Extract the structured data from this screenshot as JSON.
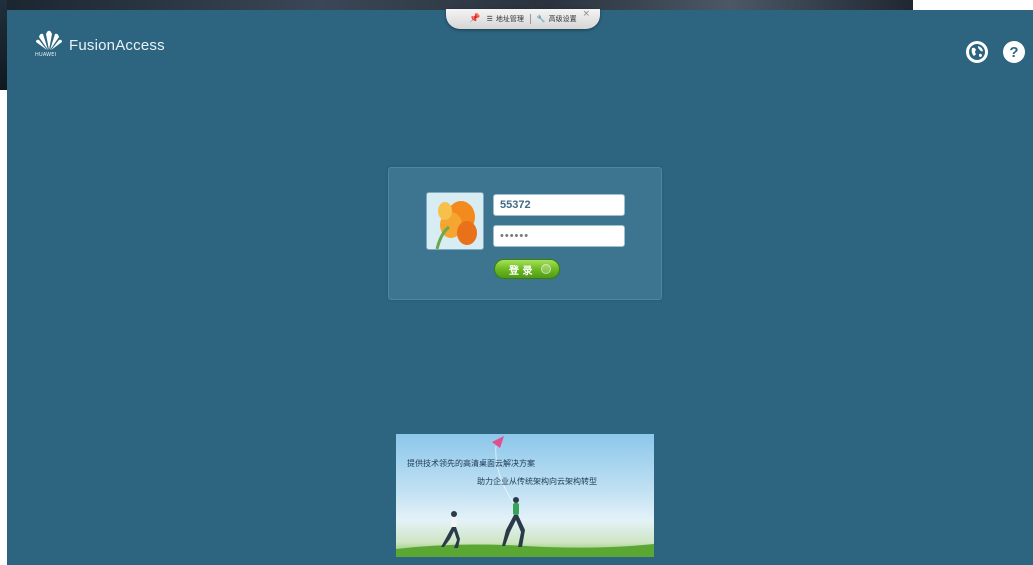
{
  "toolbar": {
    "address_label": "地址管理",
    "settings_label": "高级设置"
  },
  "brand": {
    "caption": "HUAWEI",
    "name": "FusionAccess"
  },
  "login": {
    "username_value": "55372",
    "password_value": "••••••",
    "login_label": "登 录"
  },
  "banner": {
    "line1": "提供技术领先的高清桌面云解决方案",
    "line2": "助力企业从传统架构向云架构转型"
  },
  "colors": {
    "background": "#2d6580",
    "panel": "#3d7590",
    "button": "#6dbb22"
  }
}
